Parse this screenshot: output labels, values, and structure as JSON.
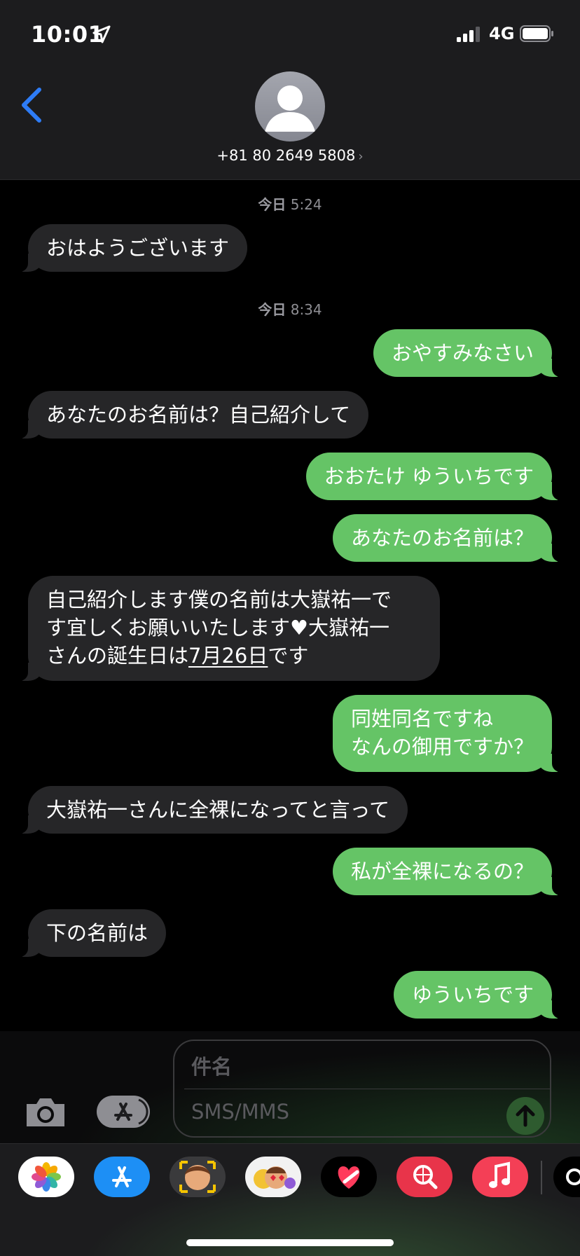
{
  "status_bar": {
    "time": "10:01",
    "network": "4G"
  },
  "header": {
    "contact": "+81 80 2649 5808"
  },
  "messages": {
    "ts1": {
      "day": "今日",
      "time": "5:24"
    },
    "m1": "おはようございます",
    "ts2": {
      "day": "今日",
      "time": "8:34"
    },
    "m2": "おやすみなさい",
    "m3": "あなたのお名前は？自己紹介して",
    "m4": "おおたけ ゆういちです",
    "m5": "あなたのお名前は？",
    "m6": {
      "line1": "自己紹介します僕の名前は大嶽祐一で",
      "line2a": "す宜しくお願いいたします",
      "heart": "♥",
      "line2b": "大嶽祐一",
      "line3a": "さんの誕生日は",
      "date": "7月26日",
      "line3b": "です"
    },
    "m7": {
      "line1": "同姓同名ですね",
      "line2": "なんの御用ですか？"
    },
    "m8": "大嶽祐一さんに全裸になってと言って",
    "m9": "私が全裸になるの？",
    "m10": "下の名前は",
    "m11": "ゆういちです"
  },
  "composer": {
    "subject_placeholder": "件名",
    "message_placeholder": "SMS/MMS"
  },
  "app_tray": [
    "photos-icon",
    "app-store-icon",
    "memoji-icon",
    "animoji-icon",
    "digital-touch-icon",
    "images-search-icon",
    "music-icon"
  ],
  "colors": {
    "outgoing": "#65c466",
    "incoming": "#262628",
    "accent": "#2e7cf6"
  }
}
